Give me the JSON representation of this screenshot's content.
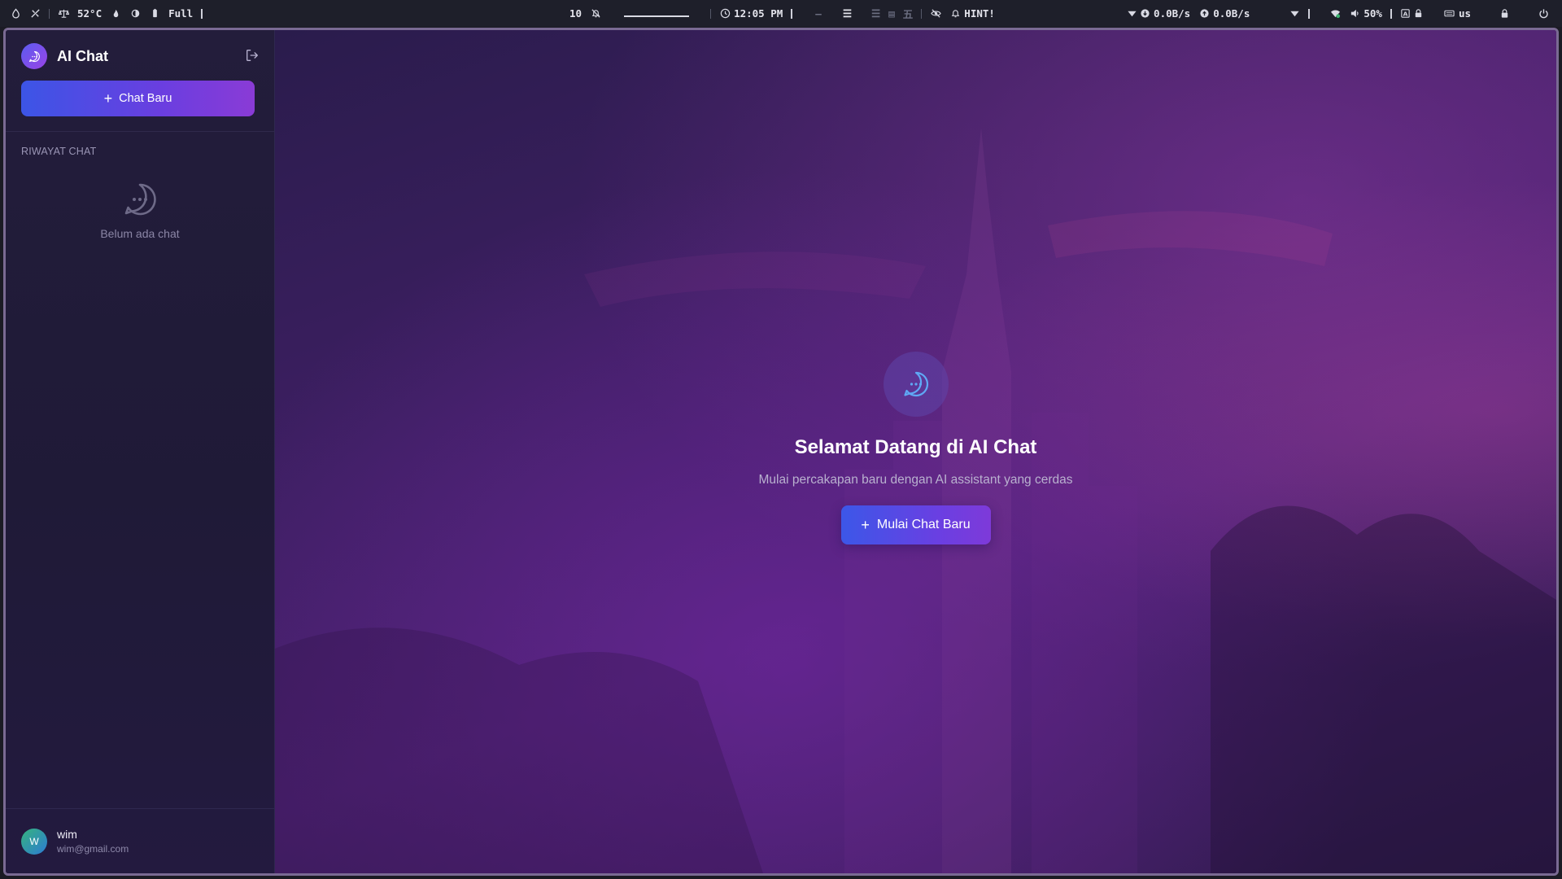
{
  "topbar": {
    "temperature": "52°C",
    "battery": "Full",
    "workspace": "10",
    "underline_text": "_________",
    "clock": "12:05 PM",
    "hint": "HINT!",
    "net_down": "0.0B/s",
    "net_up": "0.0B/s",
    "volume": "50%",
    "keyboard_layout": "us"
  },
  "sidebar": {
    "app_title": "AI Chat",
    "new_chat_label": "Chat Baru",
    "history_title": "RIWAYAT CHAT",
    "empty_text": "Belum ada chat",
    "user": {
      "initial": "W",
      "name": "wim",
      "email": "wim@gmail.com"
    }
  },
  "main": {
    "welcome_title": "Selamat Datang di AI Chat",
    "welcome_subtitle": "Mulai percakapan baru dengan AI assistant yang cerdas",
    "start_button_label": "Mulai Chat Baru"
  },
  "colors": {
    "accent_blue": "#3c55e6",
    "accent_purple": "#8a3bd6",
    "sidebar_bg": "#211b3a",
    "main_bg": "#3e1f63"
  },
  "icons": {
    "brand": "chat-bubble-icon",
    "logout": "logout-icon",
    "empty": "chat-bubble-icon",
    "welcome": "chat-bubble-icon"
  }
}
